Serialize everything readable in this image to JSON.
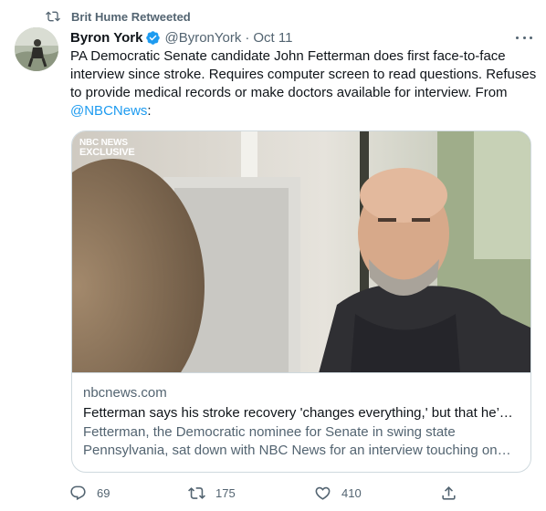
{
  "social_context": {
    "text": "Brit Hume Retweeted",
    "icon": "retweet-icon"
  },
  "author": {
    "name": "Byron York",
    "verified": true,
    "handle": "@ByronYork",
    "separator": "·",
    "date": "Oct 11"
  },
  "tweet": {
    "text_before_mention": "PA Democratic Senate candidate John Fetterman does first face-to-face interview since stroke. Requires computer screen to read questions. Refuses to provide medical records or make doctors available for interview. From ",
    "mention": "@NBCNews",
    "text_after_mention": ":"
  },
  "card": {
    "badge_line1": "NBC NEWS",
    "badge_line2": "EXCLUSIVE",
    "domain": "nbcnews.com",
    "title": "Fetterman says his stroke recovery 'changes everything,' but that he’s…",
    "description": "Fetterman, the Democratic nominee for Senate in swing state Pennsylvania, sat down with NBC News for an interview touching on h…"
  },
  "actions": {
    "reply": {
      "icon": "reply-icon",
      "count": "69"
    },
    "retweet": {
      "icon": "retweet-icon",
      "count": "175"
    },
    "like": {
      "icon": "heart-icon",
      "count": "410"
    },
    "share": {
      "icon": "share-icon"
    }
  },
  "colors": {
    "text_primary": "#0f1419",
    "text_secondary": "#536471",
    "link": "#1d9bf0",
    "border": "#cfd9de"
  }
}
